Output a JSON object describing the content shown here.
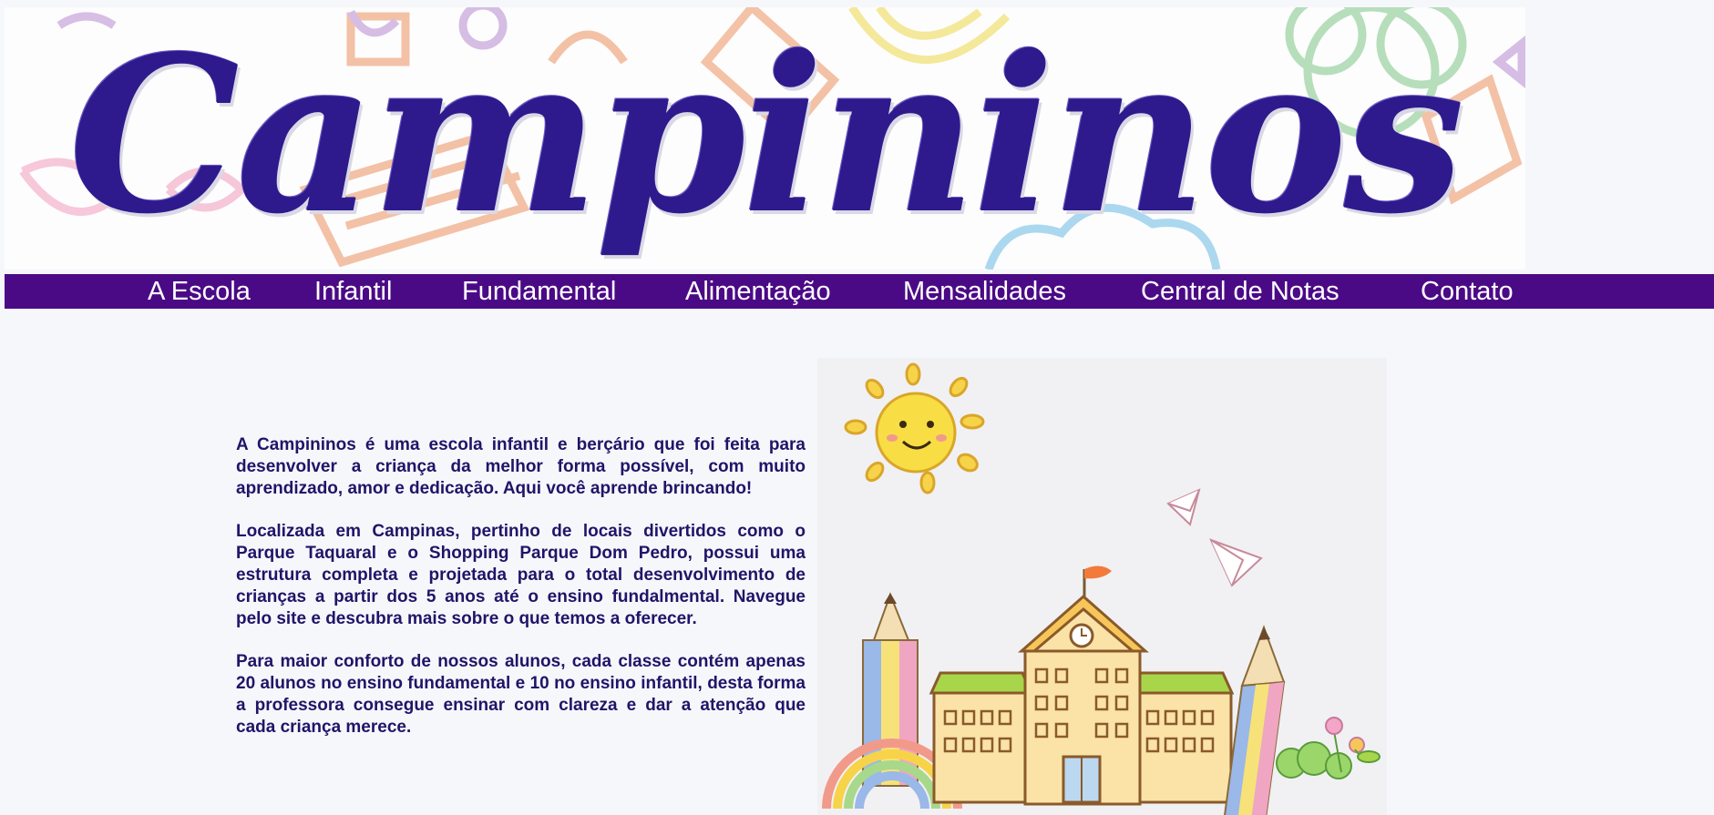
{
  "header": {
    "logo_text": "Campininos"
  },
  "nav": {
    "items": [
      {
        "label": "A Escola"
      },
      {
        "label": "Infantil"
      },
      {
        "label": "Fundamental"
      },
      {
        "label": "Alimentação"
      },
      {
        "label": "Mensalidades"
      },
      {
        "label": "Central de Notas"
      },
      {
        "label": "Contato"
      }
    ]
  },
  "main": {
    "paragraphs": [
      "A Campininos é uma escola infantil e berçário que foi feita para desenvolver a criança da melhor forma possível, com muito aprendizado, amor e dedicação. Aqui você aprende brincando!",
      "Localizada em Campinas, pertinho de locais divertidos como o Parque Taquaral e o Shopping Parque Dom Pedro, possui uma estrutura completa e projetada para o total desenvolvimento de crianças a partir dos 5 anos até o ensino fundalmental. Navegue pelo site e descubra mais sobre o que temos a oferecer.",
      "Para maior conforto de nossos alunos, cada classe contém apenas 20 alunos no ensino fundamental e 10 no ensino infantil, desta forma a professora consegue ensinar com clareza e dar a atenção que cada criança merece."
    ]
  },
  "colors": {
    "nav_background": "#4b0a85",
    "logo_text": "#2e1a8c",
    "body_text": "#1f1568",
    "page_background": "#f6f7fb"
  }
}
